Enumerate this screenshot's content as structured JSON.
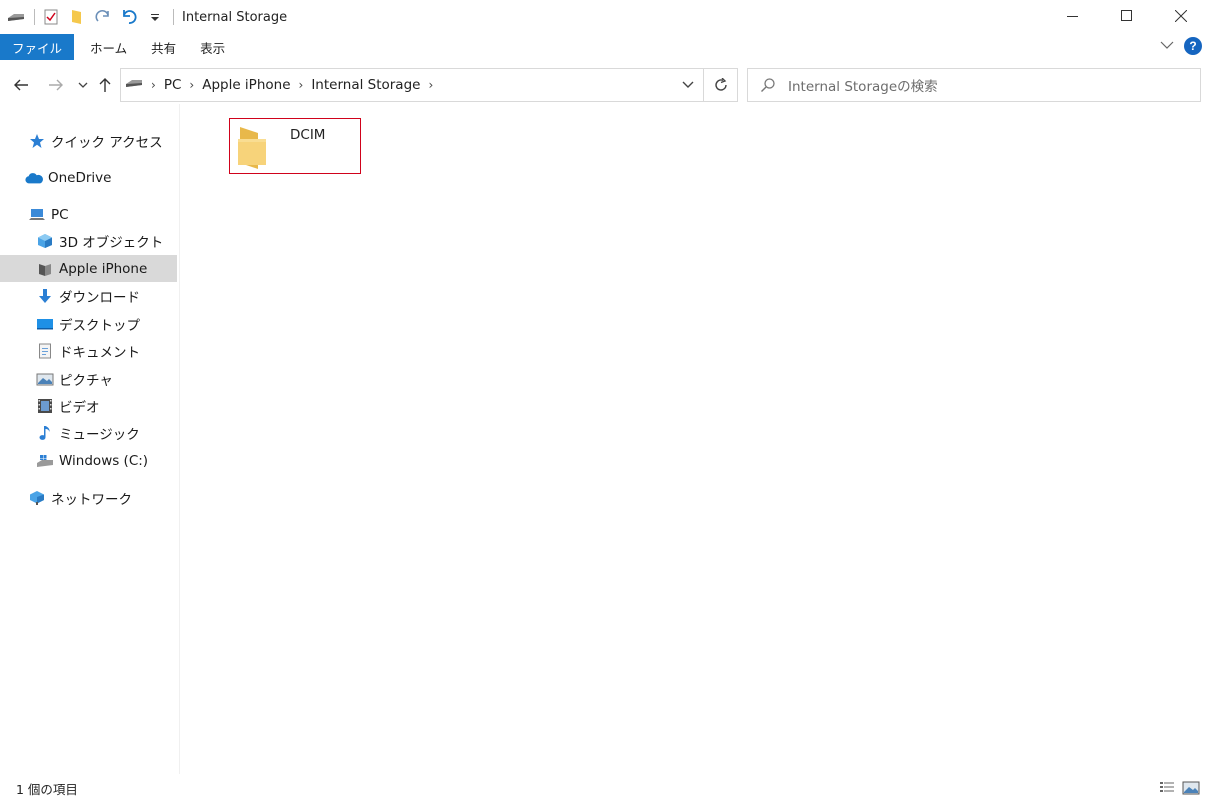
{
  "window": {
    "title": "Internal Storage",
    "controls": {
      "minimize": "—",
      "maximize": "☐",
      "close": "✕"
    }
  },
  "ribbon": {
    "tabs": [
      {
        "label": "ファイル"
      },
      {
        "label": "ホーム"
      },
      {
        "label": "共有"
      },
      {
        "label": "表示"
      }
    ],
    "help": "?"
  },
  "address": {
    "crumbs": [
      "PC",
      "Apple iPhone",
      "Internal Storage"
    ]
  },
  "search": {
    "placeholder": "Internal Storageの検索"
  },
  "sidebar": {
    "items": [
      {
        "label": "クイック アクセス",
        "icon": "star-icon"
      },
      {
        "label": "OneDrive",
        "icon": "cloud-icon"
      },
      {
        "label": "PC",
        "icon": "computer-icon"
      },
      {
        "label": "3D オブジェクト",
        "icon": "cube-icon"
      },
      {
        "label": "Apple iPhone",
        "icon": "phone-icon"
      },
      {
        "label": "ダウンロード",
        "icon": "download-icon"
      },
      {
        "label": "デスクトップ",
        "icon": "desktop-icon"
      },
      {
        "label": "ドキュメント",
        "icon": "document-icon"
      },
      {
        "label": "ピクチャ",
        "icon": "picture-icon"
      },
      {
        "label": "ビデオ",
        "icon": "video-icon"
      },
      {
        "label": "ミュージック",
        "icon": "music-icon"
      },
      {
        "label": "Windows (C:)",
        "icon": "drive-icon"
      },
      {
        "label": "ネットワーク",
        "icon": "network-icon"
      }
    ],
    "selected": "Apple iPhone"
  },
  "content": {
    "items": [
      {
        "name": "DCIM",
        "type": "folder",
        "highlighted": true
      }
    ]
  },
  "status": {
    "count": "1 個の項目"
  },
  "colors": {
    "accent": "#1979ca",
    "highlight_border": "#d0021b",
    "selected_bg": "#d9d9d9",
    "folder": "#f5c84c"
  }
}
